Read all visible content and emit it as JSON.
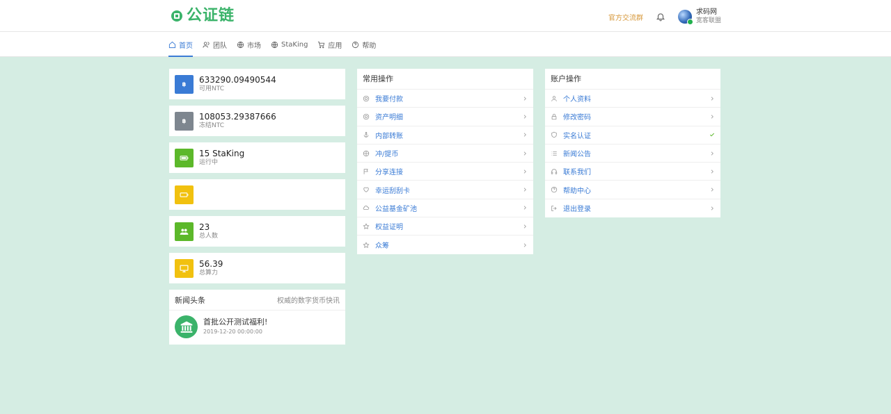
{
  "header": {
    "brand": "公证链",
    "group_link": "官方交流群",
    "user_name": "求码网",
    "user_sub": "宽客联盟"
  },
  "nav": [
    {
      "label": "首页",
      "icon": "home-icon",
      "active": true
    },
    {
      "label": "团队",
      "icon": "team-icon"
    },
    {
      "label": "市场",
      "icon": "globe-icon"
    },
    {
      "label": "StaKing",
      "icon": "globe-icon"
    },
    {
      "label": "应用",
      "icon": "cart-icon"
    },
    {
      "label": "帮助",
      "icon": "help-icon"
    }
  ],
  "stats": [
    {
      "value": "633290.09490544",
      "label": "可用NTC",
      "color": "#3a7bd5",
      "icon": "bitcoin-icon"
    },
    {
      "value": "108053.29387666",
      "label": "冻结NTC",
      "color": "#7e868f",
      "icon": "bitcoin-icon"
    },
    {
      "value": "15 StaKing",
      "label": "运行中",
      "color": "#5cb82a",
      "icon": "battery-icon"
    },
    {
      "value": "",
      "label": "",
      "color": "#f1c10f",
      "icon": "battery-empty-icon"
    },
    {
      "value": "23",
      "label": "总人数",
      "color": "#5cb82a",
      "icon": "users-icon"
    },
    {
      "value": "56.39",
      "label": "总算力",
      "color": "#f1c10f",
      "icon": "monitor-icon"
    }
  ],
  "news": {
    "title": "新闻头条",
    "subtitle": "权威的数字货币快讯",
    "items": [
      {
        "title": "首批公开测试福利!",
        "date": "2019-12-20 00:00:00"
      }
    ]
  },
  "common_ops": {
    "title": "常用操作",
    "items": [
      {
        "label": "我要付款",
        "icon": "coin-icon"
      },
      {
        "label": "资产明细",
        "icon": "coin-icon"
      },
      {
        "label": "内部转账",
        "icon": "anchor-icon"
      },
      {
        "label": "冲/提币",
        "icon": "aperture-icon"
      },
      {
        "label": "分享连接",
        "icon": "flag-icon"
      },
      {
        "label": "幸运刮刮卡",
        "icon": "heart-icon"
      },
      {
        "label": "公益基金矿池",
        "icon": "cloud-icon"
      },
      {
        "label": "权益证明",
        "icon": "star-icon"
      },
      {
        "label": "众筹",
        "icon": "star-icon"
      }
    ]
  },
  "account_ops": {
    "title": "账户操作",
    "items": [
      {
        "label": "个人资料",
        "icon": "user-icon"
      },
      {
        "label": "修改密码",
        "icon": "lock-icon"
      },
      {
        "label": "实名认证",
        "icon": "shield-icon",
        "verified": true
      },
      {
        "label": "新闻公告",
        "icon": "list-icon"
      },
      {
        "label": "联系我们",
        "icon": "headphones-icon"
      },
      {
        "label": "帮助中心",
        "icon": "help-icon"
      },
      {
        "label": "退出登录",
        "icon": "logout-icon"
      }
    ]
  }
}
